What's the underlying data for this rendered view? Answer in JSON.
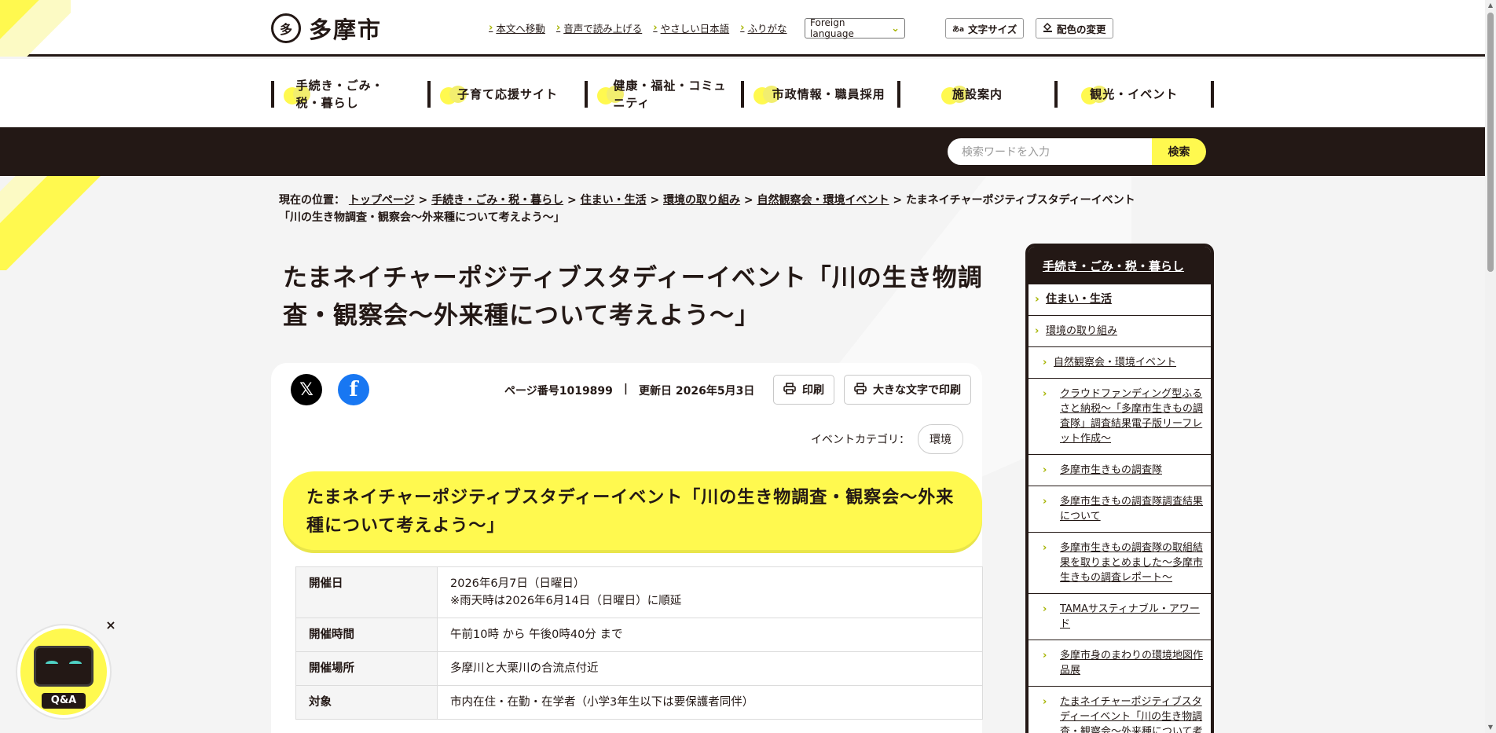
{
  "header": {
    "site_name": "多摩市",
    "logo_mark": "多",
    "util_links": [
      "本文へ移動",
      "音声で読み上げる",
      "やさしい日本語",
      "ふりがな"
    ],
    "foreign_language": "Foreign language",
    "text_size_label": "文字サイズ",
    "text_size_icon_text": "あa",
    "color_change_label": "配色の変更"
  },
  "nav": {
    "items": [
      "手続き・ごみ・税・暮らし",
      "子育て応援サイト",
      "健康・福祉・コミュニティ",
      "市政情報・職員採用",
      "施設案内",
      "観光・イベント"
    ]
  },
  "search": {
    "placeholder": "検索ワードを入力",
    "button": "検索"
  },
  "breadcrumb": {
    "label": "現在の位置：",
    "links": [
      "トップページ",
      "手続き・ごみ・税・暮らし",
      "住まい・生活",
      "環境の取り組み",
      "自然観察会・環境イベント"
    ],
    "current_line1": "たまネイチャーポジティブスタディーイベント",
    "current_line2": "「川の生き物調査・観察会〜外来種について考えよう〜」"
  },
  "page": {
    "title": "たまネイチャーポジティブスタディーイベント「川の生き物調査・観察会〜外来種について考えよう〜」",
    "page_number": "ページ番号1019899",
    "separator": "|",
    "updated": "更新日 2026年5月3日",
    "print": "印刷",
    "print_large": "大きな文字で印刷",
    "event_category_label": "イベントカテゴリ：",
    "event_category": "環境",
    "heading": "たまネイチャーポジティブスタディーイベント「川の生き物調査・観察会〜外来種について考えよう〜」"
  },
  "social": {
    "x_glyph": "𝕏",
    "facebook_glyph": "f"
  },
  "table": {
    "rows": [
      {
        "label": "開催日",
        "value": "2026年6月7日（日曜日）",
        "value2": "※雨天時は2026年6月14日（日曜日）に順延"
      },
      {
        "label": "開催時間",
        "value": "午前10時 から 午後0時40分 まで"
      },
      {
        "label": "開催場所",
        "value": "多摩川と大栗川の合流点付近"
      },
      {
        "label": "対象",
        "value": "市内在住・在勤・在学者（小学3年生以下は要保護者同伴）"
      }
    ]
  },
  "sidebar": {
    "heading": "手続き・ごみ・税・暮らし",
    "items": [
      "住まい・生活",
      "環境の取り組み",
      "自然観察会・環境イベント",
      "クラウドファンディング型ふるさと納税〜「多摩市生きもの調査隊」調査結果電子版リーフレット作成〜",
      "多摩市生きもの調査隊",
      "多摩市生きもの調査隊調査結果について",
      "多摩市生きもの調査隊の取組結果を取りまとめました〜多摩市生きもの調査レポート〜",
      "TAMAサスティナブル・アワード",
      "多摩市身のまわりの環境地図作品展",
      "たまネイチャーポジティブスタディーイベント「川の生き物調査・観察会〜外来種について考え"
    ]
  },
  "qa": {
    "label": "Q&A",
    "close": "×"
  },
  "colors": {
    "accent": "#fff94f",
    "dark": "#231815",
    "chevron": "#a6b400"
  }
}
